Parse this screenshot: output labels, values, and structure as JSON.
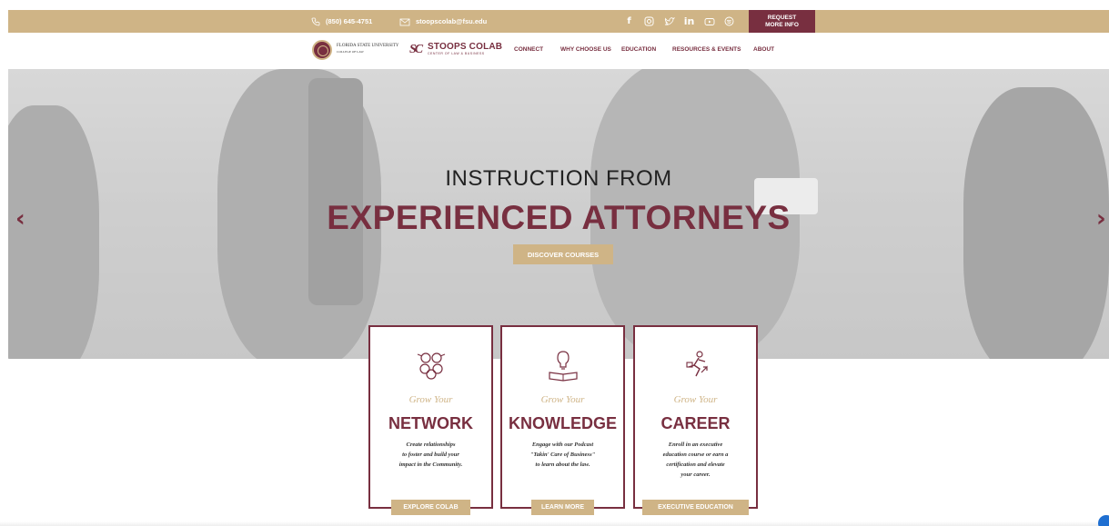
{
  "topbar": {
    "phone": "(850) 645-4751",
    "email": "stoopscolab@fsu.edu",
    "request_line1": "REQUEST",
    "request_line2": "MORE INFO",
    "social_icons": [
      "facebook-icon",
      "instagram-icon",
      "twitter-icon",
      "linkedin-icon",
      "youtube-icon",
      "spotify-icon"
    ]
  },
  "nav": {
    "fsu_name": "FLORIDA STATE UNIVERSITY",
    "fsu_sub": "COLLEGE OF LAW",
    "brand_mark": "SC",
    "brand_name": "STOOPS COLAB",
    "brand_sub": "CENTER OF LAW & BUSINESS",
    "items": [
      "CONNECT",
      "WHY CHOOSE US",
      "EDUCATION",
      "RESOURCES & EVENTS",
      "ABOUT"
    ]
  },
  "hero": {
    "line1": "INSTRUCTION FROM",
    "line2": "EXPERIENCED ATTORNEYS",
    "button": "DISCOVER COURSES",
    "prev_arrow": "‹",
    "next_arrow": "›"
  },
  "cards": [
    {
      "icon": "network-people-icon",
      "grow": "Grow Your",
      "heading": "NETWORK",
      "desc": [
        "Create relationships",
        "to foster and build your",
        "impact in the Community."
      ],
      "button": "EXPLORE COLAB"
    },
    {
      "icon": "lightbulb-book-icon",
      "grow": "Grow Your",
      "heading": "KNOWLEDGE",
      "desc": [
        "Engage with our Podcast",
        "\"Takin' Care of Business\"",
        "to learn about the law."
      ],
      "button": "LEARN MORE"
    },
    {
      "icon": "career-climb-icon",
      "grow": "Grow Your",
      "heading": "CAREER",
      "desc": [
        "Enroll in an executive",
        "education course or earn a",
        "certification and elevate",
        "your career."
      ],
      "button": "EXECUTIVE EDUCATION"
    }
  ],
  "colors": {
    "garnet": "#782f40",
    "gold": "#cfb486"
  }
}
